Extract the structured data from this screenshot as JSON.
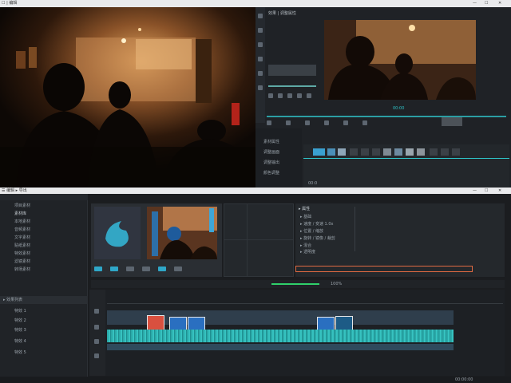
{
  "top_window": {
    "title": "☐ | 编辑",
    "controls": [
      "—",
      "☐",
      "✕"
    ],
    "panel_label": "效果 | 调整属性",
    "timecode_label": "00:00",
    "sidebar_rows": [
      "素材属性",
      "调整画面",
      "调整输出",
      "颜色调整"
    ],
    "bottom_text": "00:0"
  },
  "bottom_window": {
    "title": "☰ 编辑 ▸ 导出",
    "controls": [
      "—",
      "☐",
      "✕"
    ],
    "media_list": [
      "项目素材",
      "素材库",
      "本地素材",
      "音频素材",
      "文字素材",
      "贴纸素材",
      "特效素材",
      "滤镜素材",
      "转场素材"
    ],
    "effects_title": "▸ 效果列表",
    "effects_list": [
      "特效 1",
      "特效 2",
      "特效 3",
      "特效 4",
      "特效 5"
    ],
    "inspector_title": "▸ 属性",
    "properties": [
      "▸ 基础",
      "▸ 速度 / 变速 1.0x",
      "▸ 位置 / 缩放",
      "▸ 旋转 / 镜像 / 裁剪",
      "▸ 混合",
      "▸ 透明度"
    ],
    "zoom_label": "100%",
    "status_text": "00:00:00"
  },
  "colors": {
    "accent": "#2fc4c8",
    "highlight_box": "#e06a42",
    "clip_red": "#d9503f",
    "clip_blue": "#2a6fc0",
    "green_bar": "#2fd06a"
  }
}
